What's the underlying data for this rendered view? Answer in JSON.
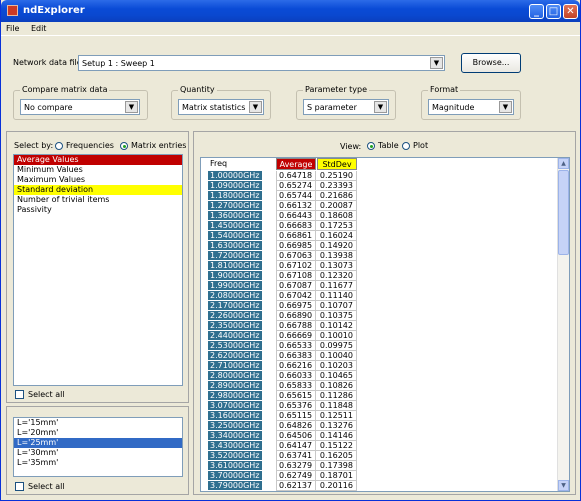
{
  "window": {
    "title": "ndExplorer",
    "minimize": "_",
    "maximize": "□",
    "close": "✕"
  },
  "menu": [
    "File",
    "Edit"
  ],
  "network": {
    "label": "Network data file:",
    "value": "Setup 1 : Sweep 1",
    "browse": "Browse..."
  },
  "compare": {
    "label": "Compare matrix data",
    "value": "No compare"
  },
  "quantity": {
    "label": "Quantity",
    "value": "Matrix statistics"
  },
  "param": {
    "label": "Parameter type",
    "value": "S parameter"
  },
  "format": {
    "label": "Format",
    "value": "Magnitude"
  },
  "selectby": {
    "label": "Select by:",
    "opt1": "Frequencies",
    "opt2": "Matrix entries",
    "selected": "Matrix entries"
  },
  "stats": [
    "Average Values",
    "Minimum Values",
    "Maximum Values",
    "Standard deviation",
    "Number of trivial items",
    "Passivity"
  ],
  "selectall1": "Select all",
  "variations": [
    "L='15mm'",
    "L='20mm'",
    "L='25mm'",
    "L='30mm'",
    "L='35mm'"
  ],
  "selectall2": "Select all",
  "view": {
    "label": "View:",
    "opt1": "Table",
    "opt2": "Plot",
    "selected": "Table"
  },
  "table": {
    "headers": {
      "freq": "Freq",
      "avg": "Average",
      "std": "StdDev"
    },
    "rows": [
      [
        "1.00000GHz",
        "0.64718",
        "0.25190"
      ],
      [
        "1.09000GHz",
        "0.65274",
        "0.23393"
      ],
      [
        "1.18000GHz",
        "0.65744",
        "0.21686"
      ],
      [
        "1.27000GHz",
        "0.66132",
        "0.20087"
      ],
      [
        "1.36000GHz",
        "0.66443",
        "0.18608"
      ],
      [
        "1.45000GHz",
        "0.66683",
        "0.17253"
      ],
      [
        "1.54000GHz",
        "0.66861",
        "0.16024"
      ],
      [
        "1.63000GHz",
        "0.66985",
        "0.14920"
      ],
      [
        "1.72000GHz",
        "0.67063",
        "0.13938"
      ],
      [
        "1.81000GHz",
        "0.67102",
        "0.13073"
      ],
      [
        "1.90000GHz",
        "0.67108",
        "0.12320"
      ],
      [
        "1.99000GHz",
        "0.67087",
        "0.11677"
      ],
      [
        "2.08000GHz",
        "0.67042",
        "0.11140"
      ],
      [
        "2.17000GHz",
        "0.66975",
        "0.10707"
      ],
      [
        "2.26000GHz",
        "0.66890",
        "0.10375"
      ],
      [
        "2.35000GHz",
        "0.66788",
        "0.10142"
      ],
      [
        "2.44000GHz",
        "0.66669",
        "0.10010"
      ],
      [
        "2.53000GHz",
        "0.66533",
        "0.09975"
      ],
      [
        "2.62000GHz",
        "0.66383",
        "0.10040"
      ],
      [
        "2.71000GHz",
        "0.66216",
        "0.10203"
      ],
      [
        "2.80000GHz",
        "0.66033",
        "0.10465"
      ],
      [
        "2.89000GHz",
        "0.65833",
        "0.10826"
      ],
      [
        "2.98000GHz",
        "0.65615",
        "0.11286"
      ],
      [
        "3.07000GHz",
        "0.65376",
        "0.11848"
      ],
      [
        "3.16000GHz",
        "0.65115",
        "0.12511"
      ],
      [
        "3.25000GHz",
        "0.64826",
        "0.13276"
      ],
      [
        "3.34000GHz",
        "0.64506",
        "0.14146"
      ],
      [
        "3.43000GHz",
        "0.64147",
        "0.15122"
      ],
      [
        "3.52000GHz",
        "0.63741",
        "0.16205"
      ],
      [
        "3.61000GHz",
        "0.63279",
        "0.17398"
      ],
      [
        "3.70000GHz",
        "0.62749",
        "0.18701"
      ],
      [
        "3.79000GHz",
        "0.62137",
        "0.20116"
      ]
    ]
  },
  "colors": {
    "avgHeader": "#c00000",
    "stdHeader": "#ffff00",
    "freqCell": "#2f6f8f",
    "selected": "#316ac5"
  }
}
